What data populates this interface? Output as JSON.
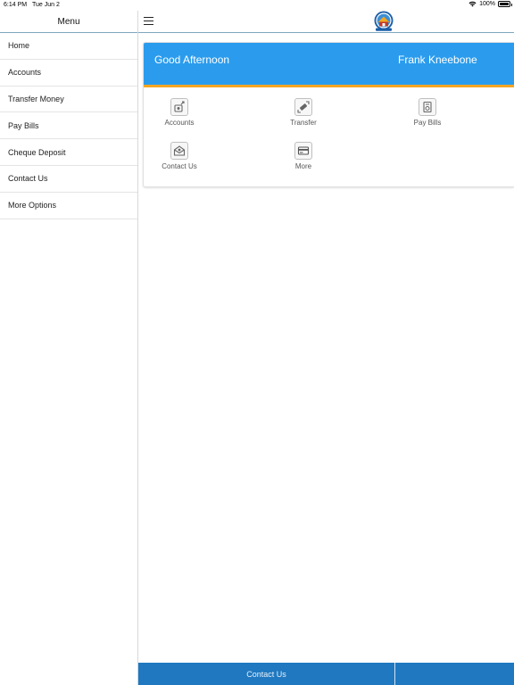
{
  "status_bar": {
    "time": "6:14 PM",
    "date": "Tue Jun 2",
    "battery_label": "100%",
    "battery_level": 1.0
  },
  "sidebar": {
    "title": "Menu",
    "items": [
      {
        "label": "Home"
      },
      {
        "label": "Accounts"
      },
      {
        "label": "Transfer Money"
      },
      {
        "label": "Pay Bills"
      },
      {
        "label": "Cheque Deposit"
      },
      {
        "label": "Contact Us"
      },
      {
        "label": "More Options"
      }
    ]
  },
  "header": {
    "menu_icon": "hamburger-menu-icon",
    "logo_icon": "bank-logo"
  },
  "card": {
    "greeting": "Good Afternoon",
    "user_name": "Frank Kneebone",
    "tiles": [
      {
        "label": "Accounts",
        "icon": "accounts-icon"
      },
      {
        "label": "Transfer",
        "icon": "transfer-icon"
      },
      {
        "label": "Pay Bills",
        "icon": "pay-bills-icon"
      },
      {
        "label": "Contact Us",
        "icon": "contact-us-icon"
      },
      {
        "label": "More",
        "icon": "more-card-icon"
      }
    ]
  },
  "bottom_bar": {
    "contact_label": "Contact Us"
  },
  "colors": {
    "banner": "#2b9ced",
    "banner_accent": "#f5a623",
    "bottom_bar": "#1f78c0"
  }
}
